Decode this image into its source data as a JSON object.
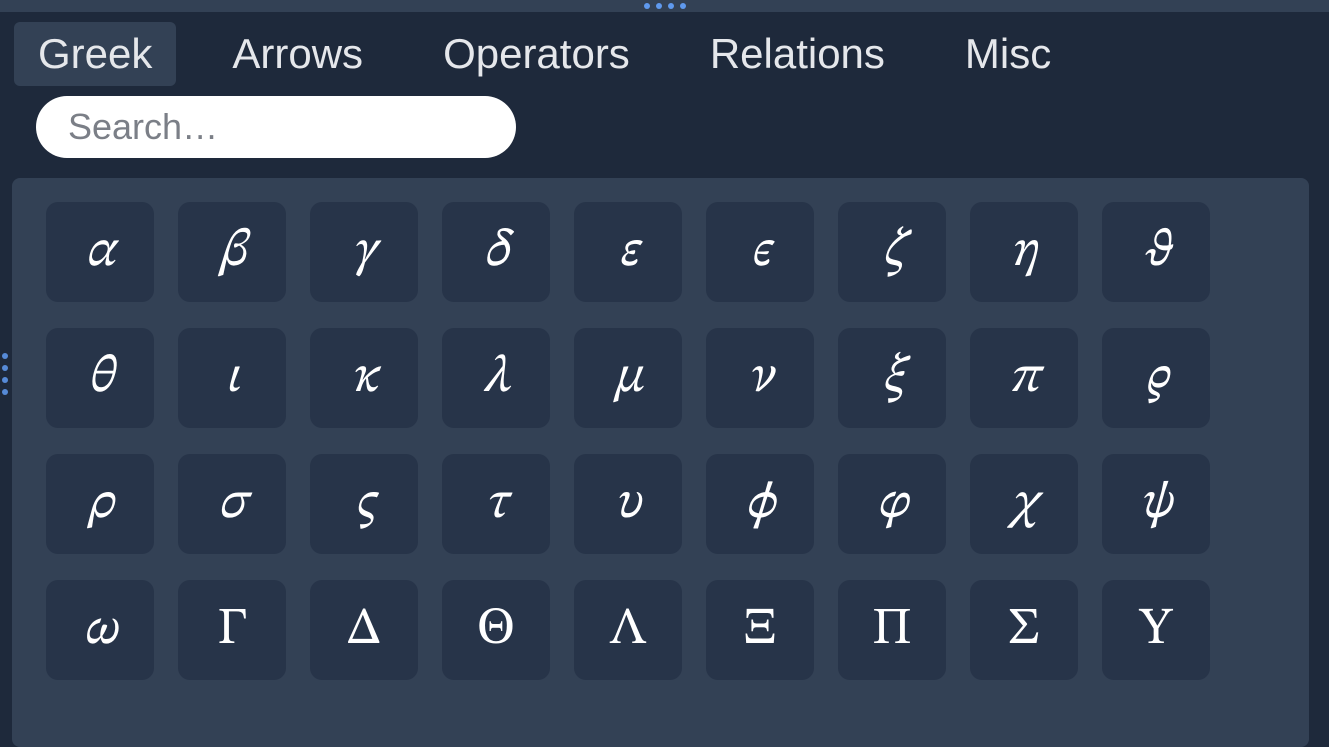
{
  "tabs": [
    {
      "label": "Greek",
      "active": true
    },
    {
      "label": "Arrows",
      "active": false
    },
    {
      "label": "Operators",
      "active": false
    },
    {
      "label": "Relations",
      "active": false
    },
    {
      "label": "Misc",
      "active": false
    }
  ],
  "search": {
    "placeholder": "Search…",
    "value": ""
  },
  "symbols": [
    {
      "glyph": "α",
      "name": "alpha",
      "upright": false
    },
    {
      "glyph": "β",
      "name": "beta",
      "upright": false
    },
    {
      "glyph": "γ",
      "name": "gamma",
      "upright": false
    },
    {
      "glyph": "δ",
      "name": "delta",
      "upright": false
    },
    {
      "glyph": "ε",
      "name": "varepsilon",
      "upright": false
    },
    {
      "glyph": "ϵ",
      "name": "epsilon",
      "upright": false
    },
    {
      "glyph": "ζ",
      "name": "zeta",
      "upright": false
    },
    {
      "glyph": "η",
      "name": "eta",
      "upright": false
    },
    {
      "glyph": "ϑ",
      "name": "vartheta",
      "upright": false
    },
    {
      "glyph": "θ",
      "name": "theta",
      "upright": false
    },
    {
      "glyph": "ι",
      "name": "iota",
      "upright": false
    },
    {
      "glyph": "κ",
      "name": "kappa",
      "upright": false
    },
    {
      "glyph": "λ",
      "name": "lambda",
      "upright": false
    },
    {
      "glyph": "μ",
      "name": "mu",
      "upright": false
    },
    {
      "glyph": "ν",
      "name": "nu",
      "upright": false
    },
    {
      "glyph": "ξ",
      "name": "xi",
      "upright": false
    },
    {
      "glyph": "π",
      "name": "pi",
      "upright": false
    },
    {
      "glyph": "ϱ",
      "name": "varrho",
      "upright": false
    },
    {
      "glyph": "ρ",
      "name": "rho",
      "upright": false
    },
    {
      "glyph": "σ",
      "name": "sigma",
      "upright": false
    },
    {
      "glyph": "ς",
      "name": "varsigma",
      "upright": false
    },
    {
      "glyph": "τ",
      "name": "tau",
      "upright": false
    },
    {
      "glyph": "υ",
      "name": "upsilon",
      "upright": false
    },
    {
      "glyph": "ϕ",
      "name": "phi",
      "upright": false
    },
    {
      "glyph": "φ",
      "name": "varphi",
      "upright": false
    },
    {
      "glyph": "χ",
      "name": "chi",
      "upright": false
    },
    {
      "glyph": "ψ",
      "name": "psi",
      "upright": false
    },
    {
      "glyph": "ω",
      "name": "omega",
      "upright": false
    },
    {
      "glyph": "Γ",
      "name": "Gamma",
      "upright": true
    },
    {
      "glyph": "Δ",
      "name": "Delta",
      "upright": true
    },
    {
      "glyph": "Θ",
      "name": "Theta",
      "upright": true
    },
    {
      "glyph": "Λ",
      "name": "Lambda",
      "upright": true
    },
    {
      "glyph": "Ξ",
      "name": "Xi",
      "upright": true
    },
    {
      "glyph": "Π",
      "name": "Pi",
      "upright": true
    },
    {
      "glyph": "Σ",
      "name": "Sigma",
      "upright": true
    },
    {
      "glyph": "Υ",
      "name": "Upsilon",
      "upright": true
    }
  ]
}
